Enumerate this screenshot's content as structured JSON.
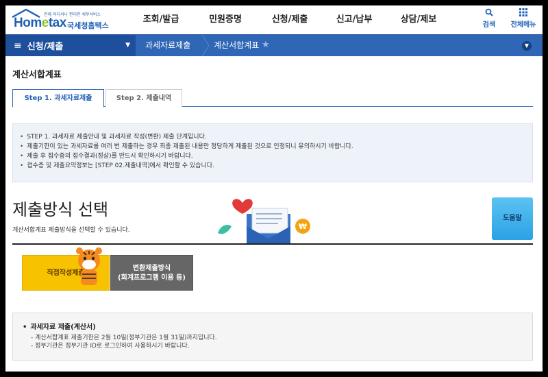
{
  "header": {
    "logo_slogan": "언제 어디서나 편리한 세무서비스",
    "logo_word_a": "Hom",
    "logo_word_e": "e",
    "logo_word_b": "tax",
    "logo_ko": "국세청홈택스",
    "nav": [
      "조회/발급",
      "민원증명",
      "신청/제출",
      "신고/납부",
      "상담/제보"
    ],
    "search_label": "검색",
    "menu_label": "전체메뉴"
  },
  "navbar": {
    "section": "신청/제출",
    "breadcrumb": [
      "과세자료제출",
      "계산서합계표"
    ]
  },
  "page": {
    "title": "계산서합계표",
    "tabs": [
      "Step 1. 과세자료제출",
      "Step 2. 제출내역"
    ],
    "info": [
      "STEP 1. 과세자료 제출안내 및 과세자료 작성(변환) 제출 단계입니다.",
      "제출기한이 있는 과세자료를 여러 번 제출하는 경우 최종 제출된 내용만 정당하게 제출된 것으로 인정되니 유의하시기 바랍니다.",
      "제출 후 접수증의 접수결과(정상)를 반드시 확인하시기 바랍니다.",
      "접수증 및 제출요약정보는 [STEP 02.제출내역]에서 확인할 수 있습니다."
    ],
    "submit_title": "제출방식 선택",
    "submit_desc": "계산서합계표 제출방식을 선택할 수 있습니다.",
    "help_label": "도움말",
    "btn_direct": "직접작성제출",
    "btn_convert_1": "변환제출방식",
    "btn_convert_2": "(회계프로그램 이용 등)",
    "notice_title": "과세자료 제출(계산서)",
    "notice_lines": [
      "- 계산서합계표 제출기한은 2월 10일(정부기관은 1월 31일)까지입니다.",
      "- 정부기관은 정부기관 ID로 로그인하여 사용하시기 바랍니다."
    ]
  },
  "colors": {
    "brand_blue": "#2f66b5",
    "button_yellow": "#f7c200",
    "button_gray": "#666666",
    "help_blue": "#3fb0ea"
  }
}
